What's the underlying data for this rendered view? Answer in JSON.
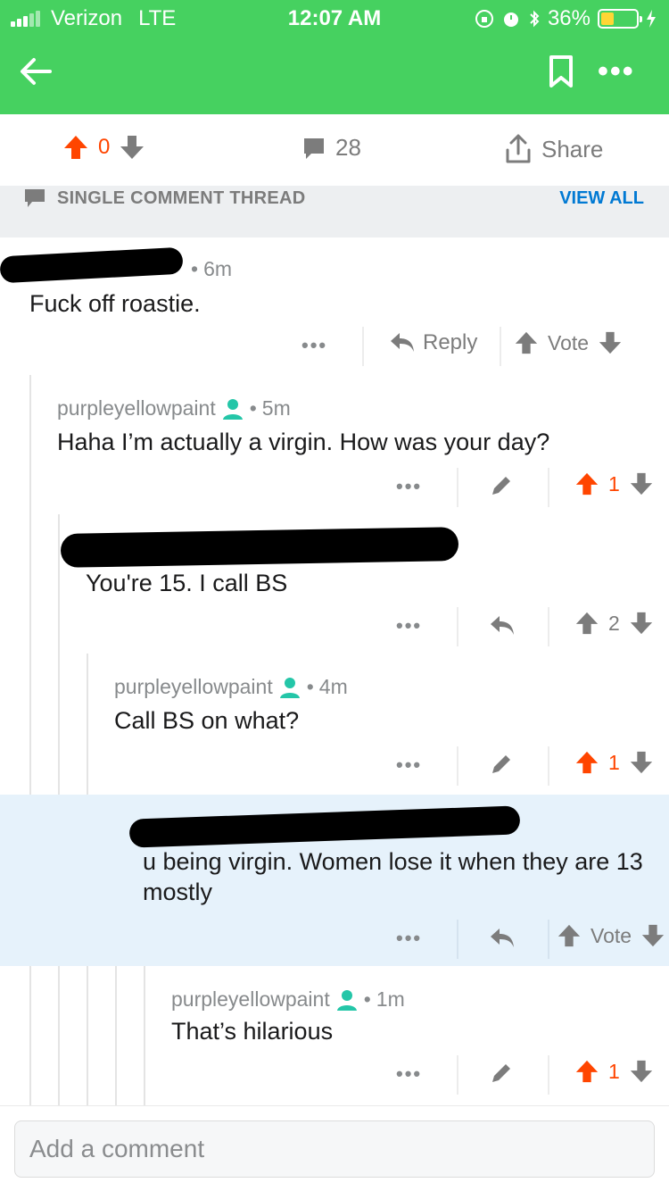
{
  "status": {
    "carrier": "Verizon",
    "network": "LTE",
    "time": "12:07 AM",
    "battery": "36%"
  },
  "post_actions": {
    "score": "0",
    "comments": "28",
    "share": "Share"
  },
  "thread_bar": {
    "label": "SINGLE COMMENT THREAD",
    "view_all": "VIEW ALL"
  },
  "comments": [
    {
      "author": "",
      "time": "6m",
      "body": "Fuck off roastie.",
      "reply": "Reply",
      "vote": "Vote"
    },
    {
      "author": "purpleyellowpaint",
      "time": "5m",
      "body": "Haha I’m actually a virgin. How was your day?",
      "score": "1"
    },
    {
      "author": "",
      "time": "",
      "body": "You're 15. I call BS",
      "score": "2"
    },
    {
      "author": "purpleyellowpaint",
      "time": "4m",
      "body": "Call BS on what?",
      "score": "1"
    },
    {
      "author": "",
      "time": "",
      "body": "u being virgin. Women lose it when they are 13 mostly",
      "vote": "Vote"
    },
    {
      "author": "purpleyellowpaint",
      "time": "1m",
      "body": "That’s hilarious",
      "score": "1"
    }
  ],
  "composer": {
    "placeholder": "Add a comment"
  },
  "colors": {
    "header": "#46d160",
    "upvote": "#ff4500",
    "link": "#0079d3",
    "op_icon": "#24c6a8",
    "highlight": "#e6f2fb"
  },
  "icons": [
    "back-arrow-icon",
    "bookmark-icon",
    "more-icon",
    "upvote-icon",
    "downvote-icon",
    "comment-icon",
    "share-icon",
    "reply-icon",
    "edit-icon",
    "user-icon"
  ]
}
